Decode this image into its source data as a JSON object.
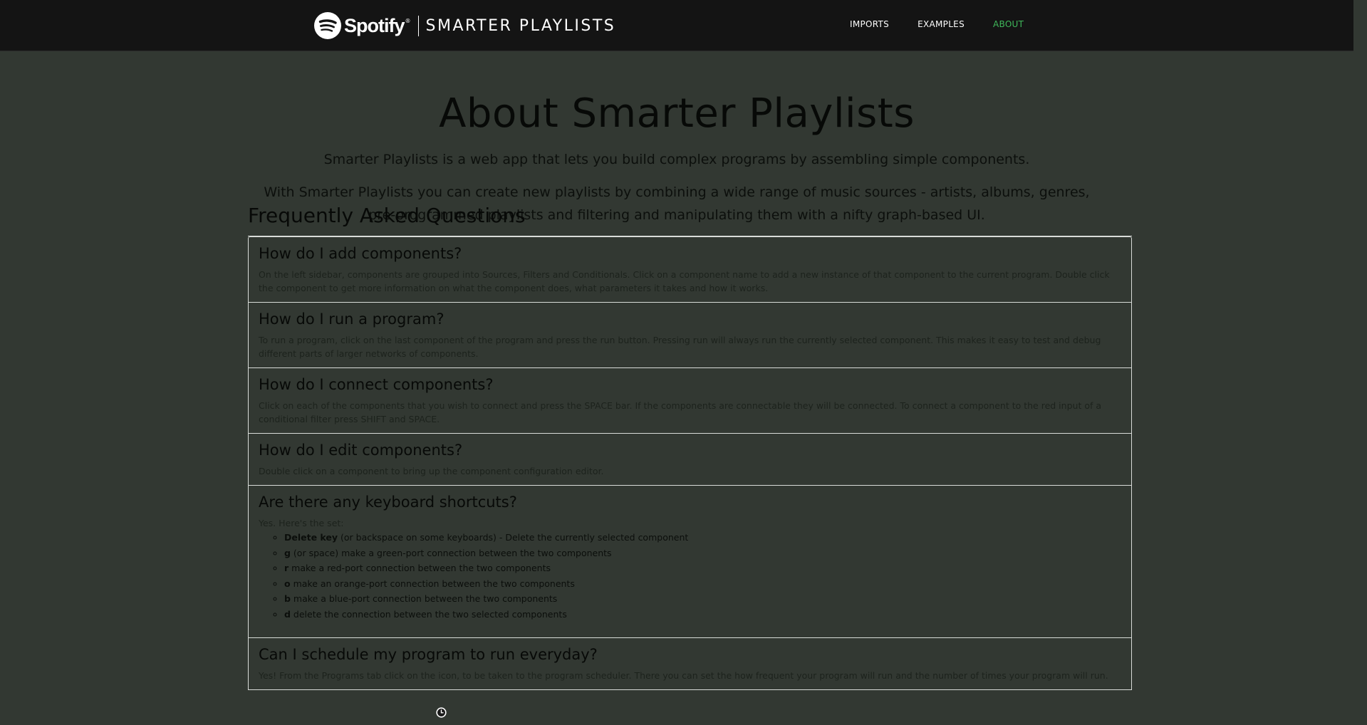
{
  "navbar": {
    "brand": "Spotify",
    "brand_mark": "®",
    "app_title": "SMARTER PLAYLISTS",
    "links": [
      {
        "label": "IMPORTS",
        "active": false
      },
      {
        "label": "EXAMPLES",
        "active": false
      },
      {
        "label": "ABOUT",
        "active": true
      }
    ]
  },
  "main": {
    "title": "About Smarter Playlists",
    "intro_1": "Smarter Playlists is a web app that lets you build complex programs by assembling simple components.",
    "intro_2": "With Smarter Playlists you can create new playlists by combining a wide range of music sources - artists, albums, genres, pre-programmed playlists and filtering and manipulating them with a nifty graph-based UI."
  },
  "faq": {
    "heading": "Frequently Asked Questions",
    "items": [
      {
        "question": "How do I add components?",
        "answer": "On the left sidebar, components are grouped into Sources, Filters and Conditionals. Click on a component name to add a new instance of that component to the current program. Double click the component to get more information on what the component does, what parameters it takes and how it works."
      },
      {
        "question": "How do I run a program?",
        "answer": "To run a program, click on the last component of the program and press the run button. Pressing run will always run the currently selected component. This makes it easy to test and debug different parts of larger networks of components."
      },
      {
        "question": "How do I connect components?",
        "answer": "Click on each of the components that you wish to connect and press the SPACE bar. If the components are connectable they will be connected. To connect a component to the red input of a conditional filter press SHIFT and SPACE."
      },
      {
        "question": "How do I edit components?",
        "answer": "Double click on a component to bring up the component configuration editor."
      },
      {
        "question": "Are there any keyboard shortcuts?",
        "answer": "Yes. Here's the set:",
        "shortcuts": [
          {
            "key": "Delete key",
            "desc": " (or backspace on some keyboards) - Delete the currently selected component"
          },
          {
            "key": "g",
            "desc": " (or space) make a green-port connection between the two components"
          },
          {
            "key": "r",
            "desc": " make a red-port connection between the two components"
          },
          {
            "key": "o",
            "desc": " make an orange-port connection between the two components"
          },
          {
            "key": "b",
            "desc": " make a blue-port connection between the two components"
          },
          {
            "key": "d",
            "desc": " delete the connection between the two selected components"
          }
        ]
      },
      {
        "question": "Can I schedule my program to run everyday?",
        "answer": "Yes! From the Programs tab click on the      icon, to be taken to the program scheduler. There you can set the how frequent your program will run and the number of times your program will run."
      }
    ]
  },
  "colors": {
    "navbar_bg": "#141414",
    "page_bg": "#323832",
    "active_link": "#3fb85a",
    "border": "#d9dcd9"
  }
}
